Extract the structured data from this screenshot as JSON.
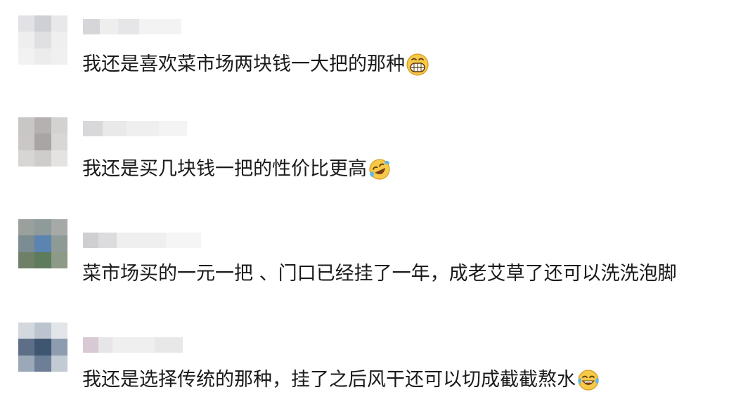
{
  "comments": [
    {
      "username_blurred": true,
      "text": "我还是喜欢菜市场两块钱一大把的那种",
      "emoji": "grinning-face-emoji",
      "avatar_colors": [
        "#e2e2e6",
        "#cfcfd6",
        "#e8e8ea",
        "#eeeeee",
        "#e0e0e2",
        "#efefef",
        "#f2f2f2",
        "#ececec",
        "#f0f0f0"
      ]
    },
    {
      "username_blurred": true,
      "text": "我还是买几块钱一把的性价比更高",
      "emoji": "crying-laughing-rolling-emoji",
      "avatar_colors": [
        "#c9c6c6",
        "#b5b1b0",
        "#d4d2d1",
        "#cbc7c6",
        "#a9a5a4",
        "#d9d7d6",
        "#d8d6d5",
        "#cfcdcc",
        "#e4e3e2"
      ]
    },
    {
      "username_blurred": true,
      "text": "菜市场买的一元一把 、门口已经挂了一年，成老艾草了还可以洗洗泡脚",
      "emoji": "",
      "avatar_colors": [
        "#9aa09b",
        "#8f9a9a",
        "#a6aaa6",
        "#7c8c93",
        "#5b84b0",
        "#8e9a96",
        "#6f8068",
        "#5e7b5c",
        "#8d9a87"
      ]
    },
    {
      "username_blurred": true,
      "text": "我还是选择传统的那种，挂了之后风干还可以切成截截熬水",
      "emoji": "tears-of-joy-emoji",
      "avatar_colors": [
        "#d3d8de",
        "#bcc5cf",
        "#e3e6e9",
        "#5c6f86",
        "#3f5670",
        "#8e9caf",
        "#9aa8b8",
        "#6c7f96",
        "#c2cad4"
      ]
    }
  ]
}
